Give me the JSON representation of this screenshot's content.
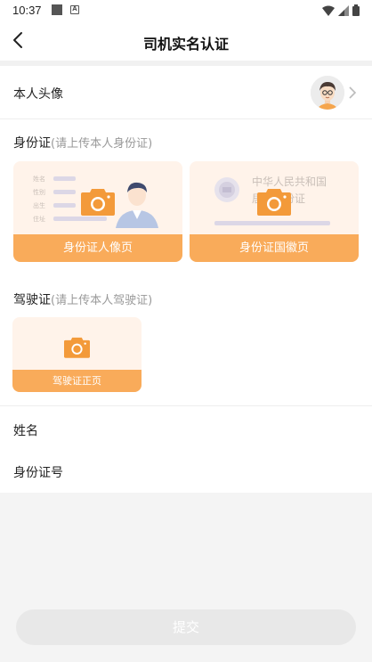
{
  "status_bar": {
    "time": "10:37"
  },
  "header": {
    "title": "司机实名认证"
  },
  "avatar_row": {
    "label": "本人头像"
  },
  "id_section": {
    "title": "身份证",
    "hint": "(请上传本人身份证)",
    "front_label": "身份证人像页",
    "back_label": "身份证国徽页",
    "front_ghost_fields": [
      "姓名",
      "性别",
      "出生",
      "住址"
    ],
    "back_ghost_lines": [
      "中华人民共和国",
      "居民身份证"
    ]
  },
  "dl_section": {
    "title": "驾驶证",
    "hint": "(请上传本人驾驶证)",
    "front_label": "驾驶证正页"
  },
  "name_row": {
    "label": "姓名",
    "value": ""
  },
  "idno_row": {
    "label": "身份证号",
    "value": ""
  },
  "submit": {
    "label": "提交"
  },
  "colors": {
    "accent": "#f9ab5a",
    "card_bg": "#fff3ea",
    "camera": "#f39a3a",
    "submit_disabled": "#e8e8e8"
  }
}
